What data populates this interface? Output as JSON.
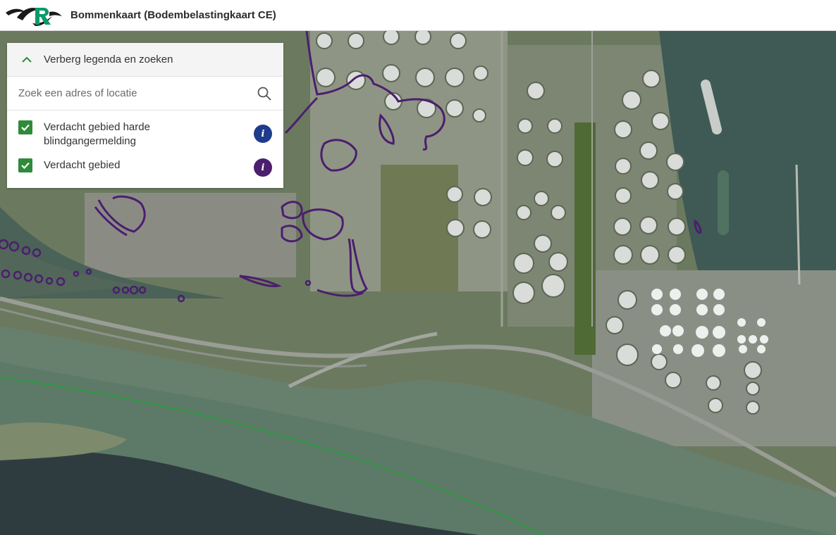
{
  "header": {
    "title": "Bommenkaart (Bodembelastingkaart CE)",
    "logo_icon": "provincial-logo-icon"
  },
  "legend": {
    "toggle_label": "Verberg legenda en zoeken",
    "toggle_icon": "chevron-up-icon",
    "search": {
      "placeholder": "Zoek een adres of locatie",
      "value": "",
      "icon": "search-icon"
    },
    "layers": [
      {
        "label": "Verdacht gebied harde blindgangermelding",
        "checked": true,
        "info_color": "#1f3b8c"
      },
      {
        "label": "Verdacht gebied",
        "checked": true,
        "info_color": "#4b1e6e"
      }
    ],
    "checkbox_color": "#2e8b3a"
  },
  "map": {
    "overlay_color": "#4b1e6e",
    "type": "aerial-photo"
  }
}
